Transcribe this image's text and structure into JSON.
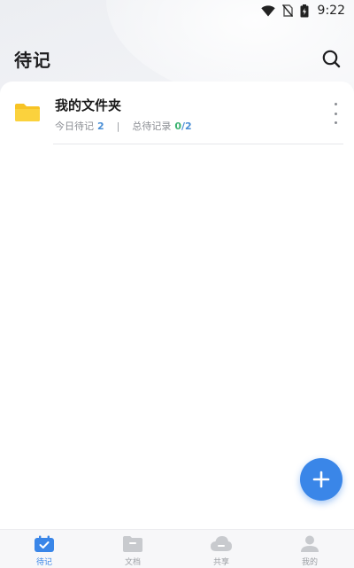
{
  "status_bar": {
    "time": "9:22"
  },
  "header": {
    "title": "待记"
  },
  "folder": {
    "name": "我的文件夹",
    "today_label": "今日待记",
    "today_count": "2",
    "separator": "|",
    "total_label": "总待记录",
    "done_count": "0",
    "total_suffix": "/2"
  },
  "nav": [
    {
      "label": "待记",
      "active": true
    },
    {
      "label": "文档",
      "active": false
    },
    {
      "label": "共享",
      "active": false
    },
    {
      "label": "我的",
      "active": false
    }
  ],
  "colors": {
    "accent": "#3a86e8",
    "folder": "#f7c325",
    "success": "#3cb371"
  }
}
